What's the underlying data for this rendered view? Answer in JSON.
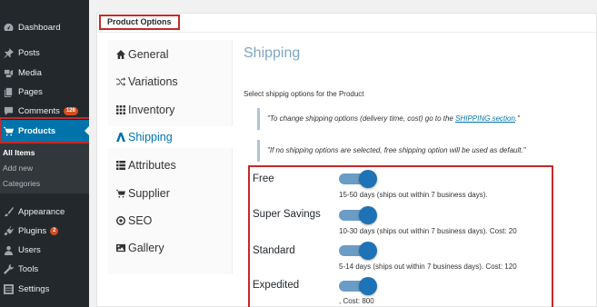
{
  "sidebar": {
    "menu": [
      {
        "label": "Dashboard",
        "icon": "dashboard-icon"
      },
      {
        "label": "Posts",
        "icon": "pin-icon"
      },
      {
        "label": "Media",
        "icon": "media-icon"
      },
      {
        "label": "Pages",
        "icon": "pages-icon"
      },
      {
        "label": "Comments",
        "icon": "comment-icon",
        "badge": "126"
      },
      {
        "label": "Products",
        "icon": "cart-icon",
        "active": true
      },
      {
        "label": "Appearance",
        "icon": "brush-icon"
      },
      {
        "label": "Plugins",
        "icon": "plug-icon",
        "badge": "2"
      },
      {
        "label": "Users",
        "icon": "users-icon"
      },
      {
        "label": "Tools",
        "icon": "wrench-icon"
      },
      {
        "label": "Settings",
        "icon": "settings-icon"
      }
    ],
    "submenu": [
      {
        "label": "All Items",
        "current": true
      },
      {
        "label": "Add new"
      },
      {
        "label": "Categories"
      }
    ]
  },
  "panel": {
    "title": "Product Options"
  },
  "tabs": [
    {
      "label": "General",
      "icon": "home-icon"
    },
    {
      "label": "Variations",
      "icon": "shuffle-icon"
    },
    {
      "label": "Inventory",
      "icon": "grid-icon"
    },
    {
      "label": "Shipping",
      "icon": "truck-icon",
      "active": true
    },
    {
      "label": "Attributes",
      "icon": "list-icon"
    },
    {
      "label": "Supplier",
      "icon": "cart-icon"
    },
    {
      "label": "SEO",
      "icon": "target-icon"
    },
    {
      "label": "Gallery",
      "icon": "image-icon"
    }
  ],
  "shipping": {
    "title": "Shipping",
    "description": "Select shippig options for the Product",
    "note1_before": "\"To change shipping options (delivery time, cost) go to the ",
    "note1_link": "SHIPPING section",
    "note1_after": ".\"",
    "note2": "\"If no shipping options are selected, free shipping option will be used as default.\"",
    "options": [
      {
        "name": "Free",
        "enabled": true,
        "details": "15-50 days (ships out within 7 business days)."
      },
      {
        "name": "Super Savings",
        "enabled": true,
        "details": "10-30 days (ships out within 7 business days). Cost: 20"
      },
      {
        "name": "Standard",
        "enabled": true,
        "details": "5-14 days (ships out within 7 business days). Cost: 120"
      },
      {
        "name": "Expedited",
        "enabled": true,
        "details": ", Cost: 800"
      }
    ]
  },
  "colors": {
    "sidebar_bg": "#23282d",
    "active_menu": "#0073aa",
    "highlight_border": "#c62828",
    "toggle_on": "#1e72b6"
  }
}
